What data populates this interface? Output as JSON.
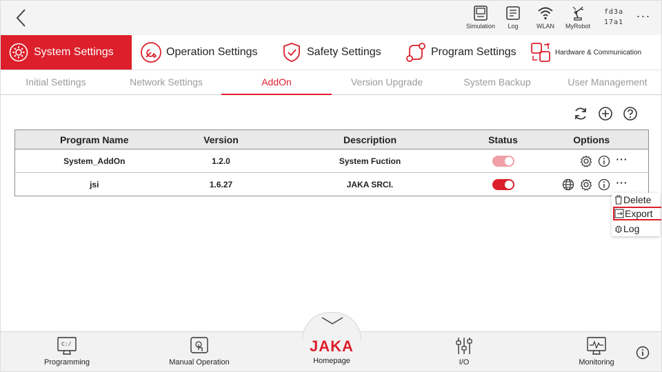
{
  "topbar": {
    "tools": [
      {
        "label": "Simulation",
        "icon": "simulation-icon"
      },
      {
        "label": "Log",
        "icon": "log-icon"
      },
      {
        "label": "WLAN",
        "icon": "wifi-icon"
      },
      {
        "label": "MyRobot",
        "icon": "robot-arm-icon"
      }
    ],
    "device_id_line1": "fd3a",
    "device_id_line2": "17a1",
    "more_label": "···"
  },
  "main_tabs": [
    {
      "label": "System Settings",
      "icon": "system-settings-icon",
      "active": true
    },
    {
      "label": "Operation Settings",
      "icon": "operation-settings-icon",
      "active": false
    },
    {
      "label": "Safety Settings",
      "icon": "shield-icon",
      "active": false
    },
    {
      "label": "Program Settings",
      "icon": "program-settings-icon",
      "active": false
    },
    {
      "label": "Hardware & Communication",
      "icon": "hardware-icon",
      "active": false
    }
  ],
  "sub_tabs": [
    {
      "label": "Initial Settings",
      "active": false
    },
    {
      "label": "Network Settings",
      "active": false
    },
    {
      "label": "AddOn",
      "active": true
    },
    {
      "label": "Version Upgrade",
      "active": false
    },
    {
      "label": "System Backup",
      "active": false
    },
    {
      "label": "User Management",
      "active": false
    }
  ],
  "table": {
    "columns": [
      "Program Name",
      "Version",
      "Description",
      "Status",
      "Options"
    ],
    "rows": [
      {
        "name": "System_AddOn",
        "version": "1.2.0",
        "description": "System Fuction",
        "status_on": true,
        "status_disabled": true,
        "options": [
          "gear-icon",
          "info-icon",
          "more-icon"
        ]
      },
      {
        "name": "jsi",
        "version": "1.6.27",
        "description": "JAKA SRCI.",
        "status_on": true,
        "status_disabled": false,
        "options": [
          "globe-icon",
          "gear-icon",
          "info-icon",
          "more-icon"
        ]
      }
    ]
  },
  "menu": {
    "items": [
      {
        "label": "Delete",
        "icon": "trash-icon",
        "highlighted": false
      },
      {
        "label": "Export",
        "icon": "export-icon",
        "highlighted": true
      },
      {
        "label": "Log",
        "icon": "bug-icon",
        "highlighted": false
      }
    ]
  },
  "bottom_nav": {
    "programming": "Programming",
    "manual": "Manual Operation",
    "brand": "JAKA",
    "homepage": "Homepage",
    "io": "I/O",
    "monitoring": "Monitoring"
  },
  "colors": {
    "accent": "#dc1f2b",
    "toggle_disabled": "#f0a0a6",
    "toggle_on": "#dc1f2b"
  }
}
